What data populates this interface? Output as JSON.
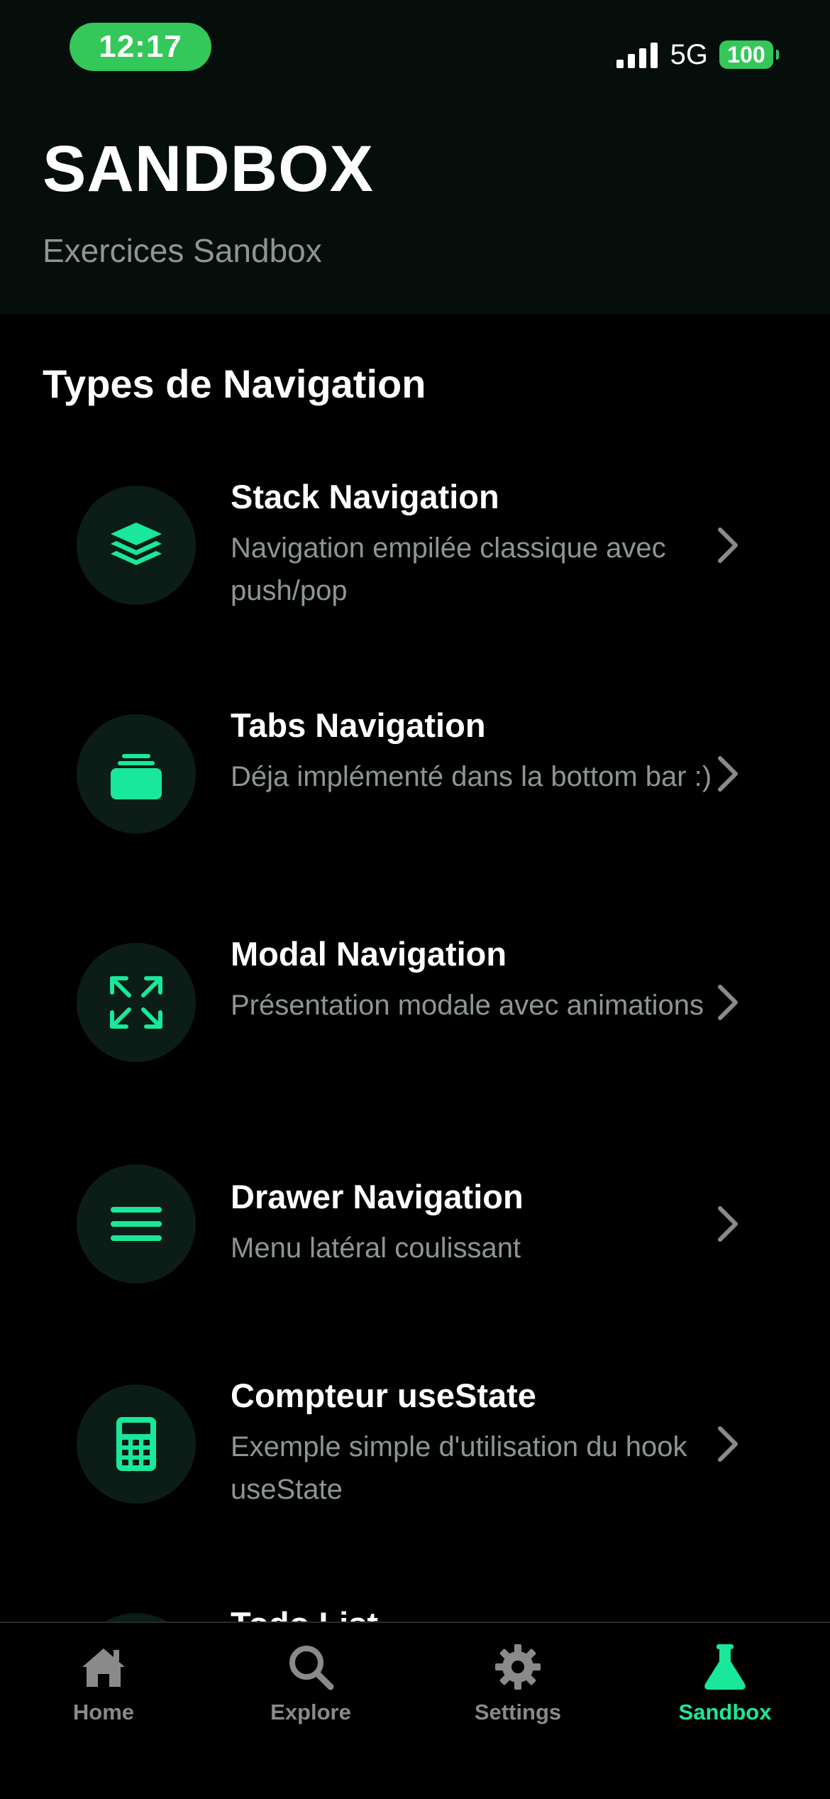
{
  "status_bar": {
    "time": "12:17",
    "network": "5G",
    "battery": "100"
  },
  "header": {
    "title": "SANDBOX",
    "subtitle": "Exercices Sandbox"
  },
  "section": {
    "title": "Types de Navigation"
  },
  "items": [
    {
      "icon": "layers-icon",
      "title": "Stack Navigation",
      "description": "Navigation empilée classique avec push/pop"
    },
    {
      "icon": "tabs-icon",
      "title": "Tabs Navigation",
      "description": "Déja implémenté dans la bottom bar :)"
    },
    {
      "icon": "expand-icon",
      "title": "Modal Navigation",
      "description": "Présentation modale avec animations"
    },
    {
      "icon": "menu-icon",
      "title": "Drawer Navigation",
      "description": "Menu latéral coulissant"
    },
    {
      "icon": "calculator-icon",
      "title": "Compteur useState",
      "description": "Exemple simple d'utilisation du hook useState"
    },
    {
      "icon": "list-icon",
      "title": "Todo List",
      "description": ""
    }
  ],
  "tabbar": {
    "tabs": [
      {
        "label": "Home",
        "icon": "home-icon",
        "active": false
      },
      {
        "label": "Explore",
        "icon": "search-icon",
        "active": false
      },
      {
        "label": "Settings",
        "icon": "gear-icon",
        "active": false
      },
      {
        "label": "Sandbox",
        "icon": "flask-icon",
        "active": true
      }
    ]
  },
  "colors": {
    "accent": "#19e89a",
    "status_green": "#34c759",
    "header_bg": "#050e0b",
    "icon_bg": "#0b1d16",
    "muted_text": "#8d9692"
  }
}
